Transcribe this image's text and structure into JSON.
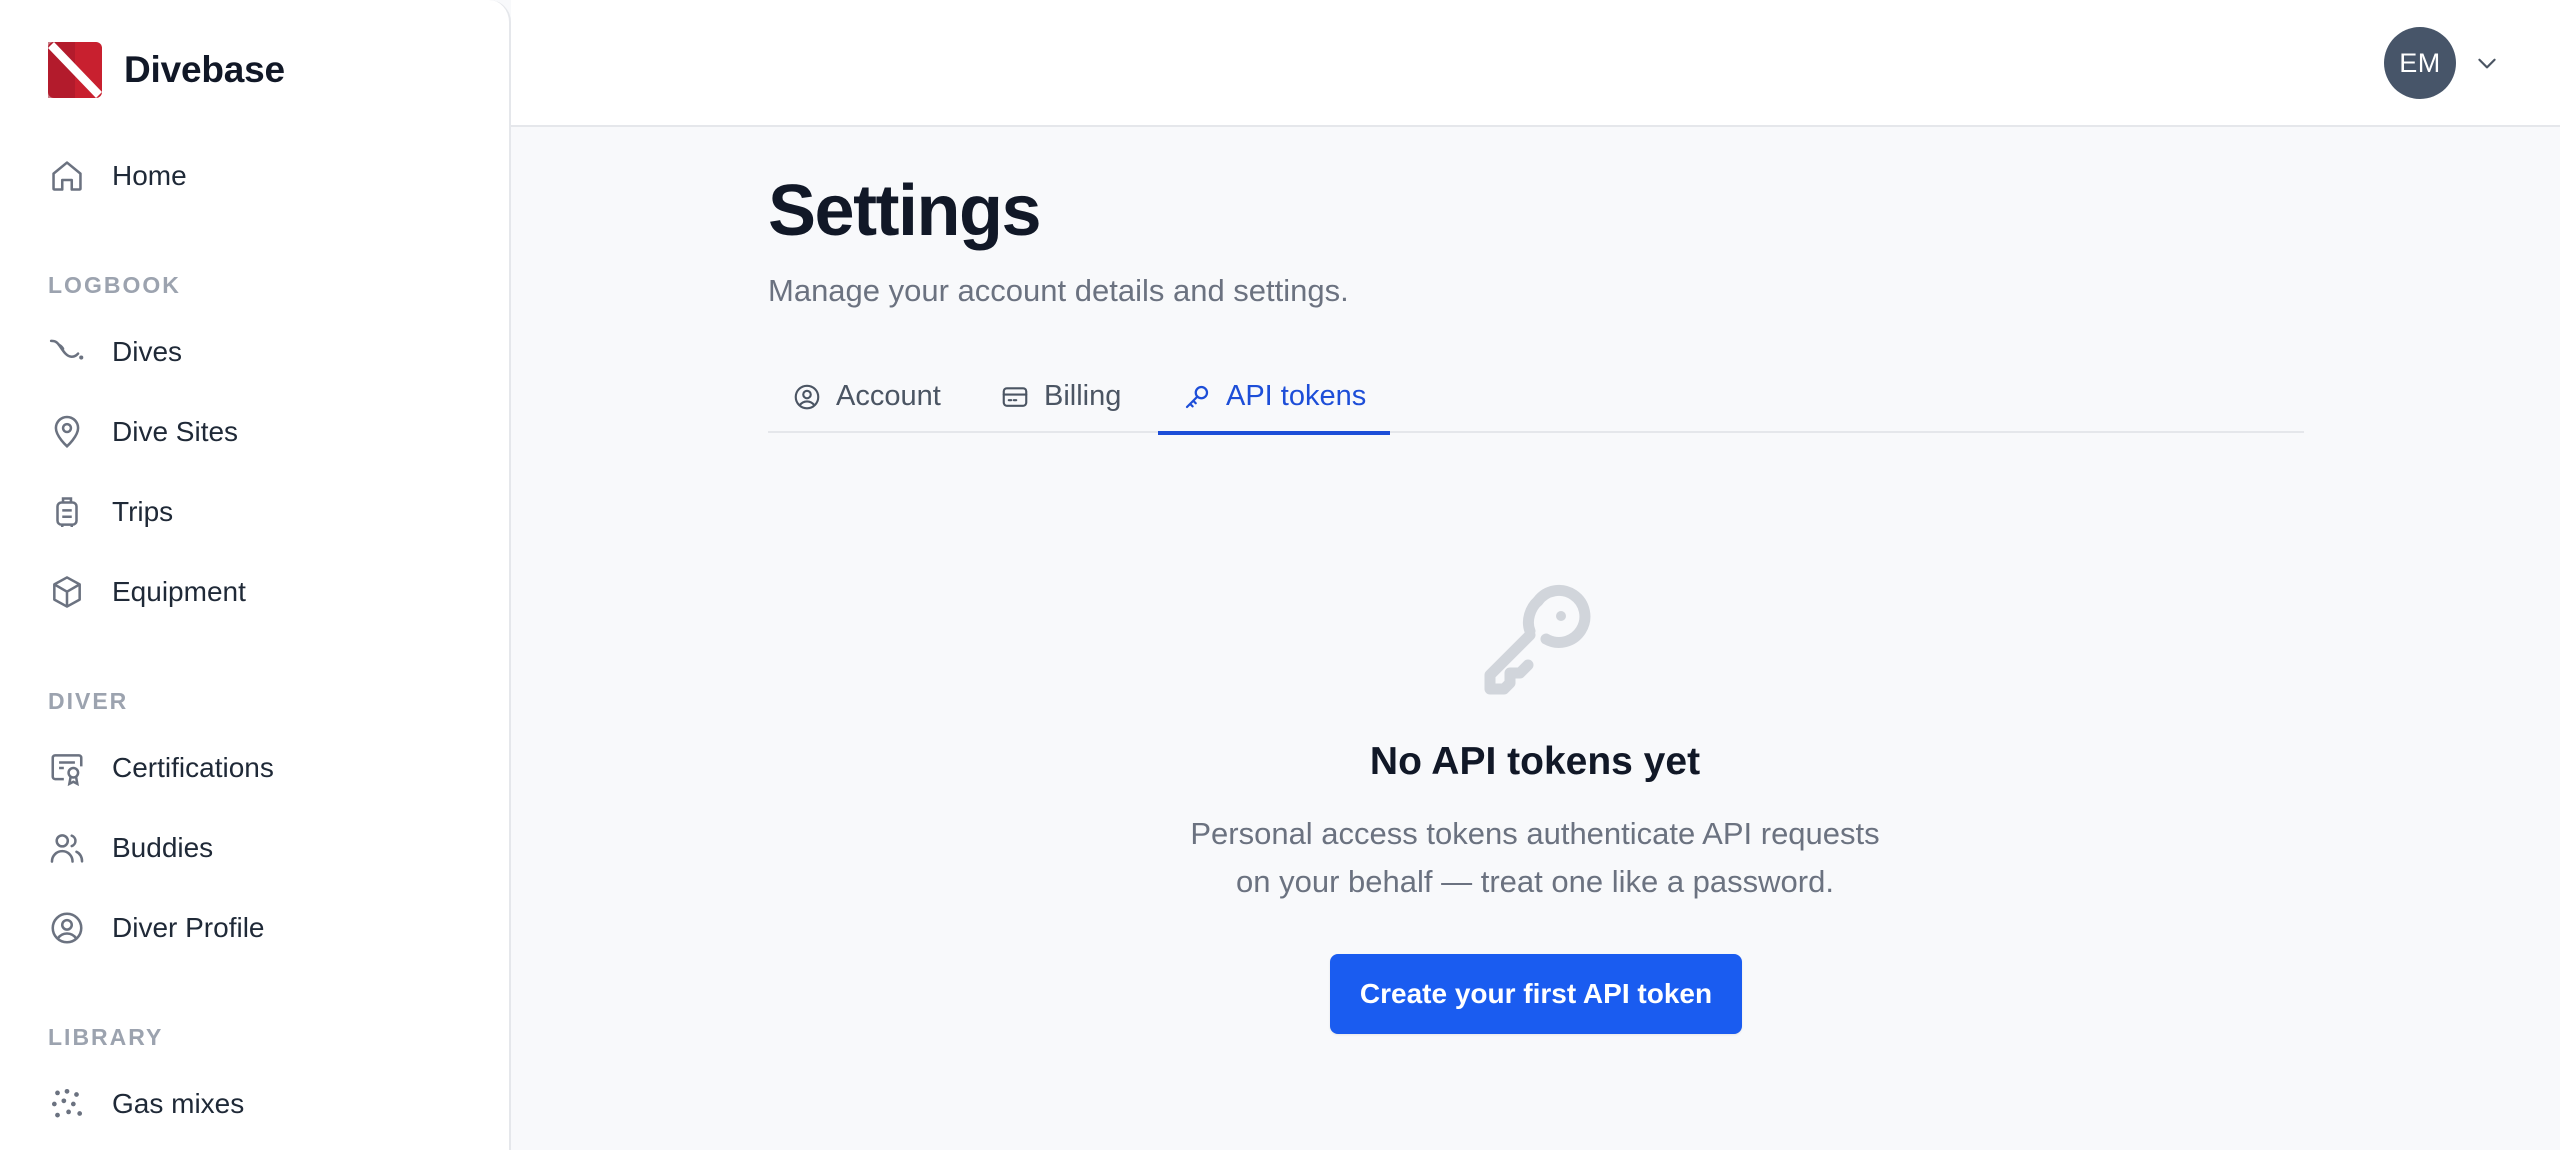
{
  "brand": {
    "name": "Divebase"
  },
  "sidebar": {
    "home": {
      "label": "Home",
      "icon": "home-icon"
    },
    "sections": [
      {
        "label": "LOGBOOK",
        "items": [
          {
            "label": "Dives",
            "icon": "dive-profile-icon"
          },
          {
            "label": "Dive Sites",
            "icon": "map-pin-icon"
          },
          {
            "label": "Trips",
            "icon": "suitcase-icon"
          },
          {
            "label": "Equipment",
            "icon": "cube-icon"
          }
        ]
      },
      {
        "label": "DIVER",
        "items": [
          {
            "label": "Certifications",
            "icon": "certificate-icon"
          },
          {
            "label": "Buddies",
            "icon": "users-icon"
          },
          {
            "label": "Diver Profile",
            "icon": "user-circle-icon"
          }
        ]
      },
      {
        "label": "LIBRARY",
        "items": [
          {
            "label": "Gas mixes",
            "icon": "bubbles-icon"
          }
        ]
      }
    ]
  },
  "header": {
    "avatar_initials": "EM"
  },
  "page": {
    "title": "Settings",
    "subtitle": "Manage your account details and settings."
  },
  "tabs": [
    {
      "label": "Account",
      "icon": "user-circle-icon",
      "active": false
    },
    {
      "label": "Billing",
      "icon": "credit-card-icon",
      "active": false
    },
    {
      "label": "API tokens",
      "icon": "key-icon",
      "active": true
    }
  ],
  "empty_state": {
    "icon": "key-icon",
    "title": "No API tokens yet",
    "description_line1": "Personal access tokens authenticate API requests",
    "description_line2": "on your behalf — treat one like a password.",
    "cta_label": "Create your first API token"
  },
  "colors": {
    "accent": "#1d4ed8",
    "button": "#1a5cf0",
    "avatar": "#475569",
    "logo_red": "#c8202f"
  }
}
